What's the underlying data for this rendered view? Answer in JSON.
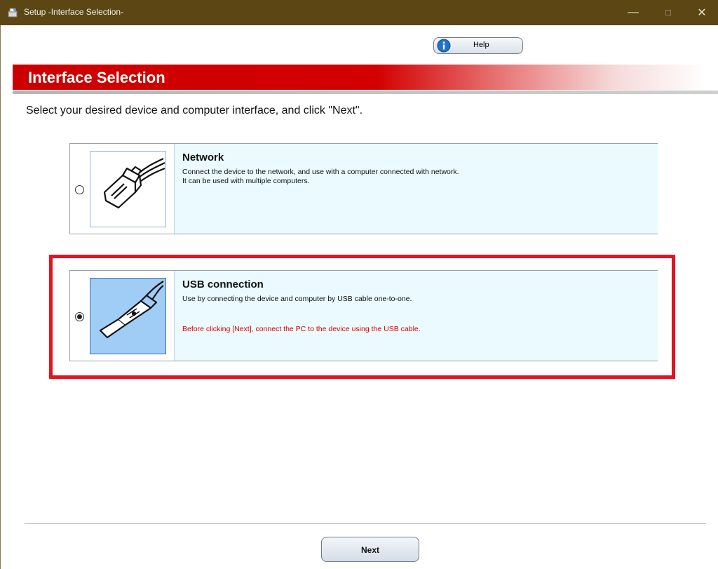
{
  "window": {
    "title": "Setup -Interface Selection-",
    "controls": {
      "minimize": "—",
      "maximize": "☐",
      "close": "✕"
    },
    "icon": "setup-app-icon"
  },
  "help_button": {
    "label": "Help",
    "icon": "info-icon"
  },
  "banner": {
    "title": "Interface Selection"
  },
  "instruction": "Select your desired device and computer interface, and click \"Next\".",
  "options": [
    {
      "title": "Network",
      "desc_line1": "Connect the device to the network, and use with a computer connected with network.",
      "desc_line2": "It can be used with multiple computers.",
      "selected": false,
      "icon": "ethernet-plug-icon"
    },
    {
      "title": "USB connection",
      "desc_line1": "Use by connecting the device and computer by USB cable one-to-one.",
      "warning": "Before clicking [Next], connect the PC to the device using the USB cable.",
      "selected": true,
      "icon": "usb-plug-icon"
    }
  ],
  "next_button": {
    "label": "Next"
  },
  "colors": {
    "titlebar": "#5b4614",
    "banner_red": "#cc0000",
    "option_bg": "#eafafe",
    "highlight": "#e3141f",
    "warning_text": "#e00000"
  }
}
